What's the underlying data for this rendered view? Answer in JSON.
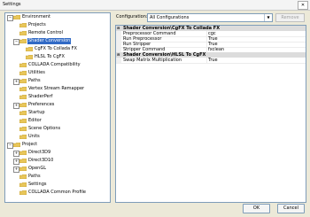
{
  "window": {
    "title": "Settings",
    "close_label": "✕"
  },
  "tree": {
    "items": [
      {
        "label": "Environment",
        "level": 0,
        "expander": "−"
      },
      {
        "label": "Projects",
        "level": 1,
        "expander": ""
      },
      {
        "label": "Remote Control",
        "level": 1,
        "expander": ""
      },
      {
        "label": "Shader Conversion",
        "level": 1,
        "expander": "−",
        "selected": true
      },
      {
        "label": "CgFX To Collada FX",
        "level": 2,
        "expander": ""
      },
      {
        "label": "HLSL To CgFX",
        "level": 2,
        "expander": ""
      },
      {
        "label": "COLLADA Compatibility",
        "level": 1,
        "expander": ""
      },
      {
        "label": "Utilities",
        "level": 1,
        "expander": ""
      },
      {
        "label": "Paths",
        "level": 1,
        "expander": "+"
      },
      {
        "label": "Vertex Stream Remapper",
        "level": 1,
        "expander": ""
      },
      {
        "label": "ShaderPerf",
        "level": 1,
        "expander": ""
      },
      {
        "label": "Preferences",
        "level": 1,
        "expander": "+"
      },
      {
        "label": "Startup",
        "level": 1,
        "expander": ""
      },
      {
        "label": "Editor",
        "level": 1,
        "expander": ""
      },
      {
        "label": "Scene Options",
        "level": 1,
        "expander": ""
      },
      {
        "label": "Units",
        "level": 1,
        "expander": ""
      },
      {
        "label": "Project",
        "level": 0,
        "expander": "−"
      },
      {
        "label": "Direct3D9",
        "level": 1,
        "expander": "+"
      },
      {
        "label": "Direct3D10",
        "level": 1,
        "expander": "+"
      },
      {
        "label": "OpenGL",
        "level": 1,
        "expander": "+"
      },
      {
        "label": "Paths",
        "level": 1,
        "expander": ""
      },
      {
        "label": "Settings",
        "level": 1,
        "expander": ""
      },
      {
        "label": "COLLADA Common Profile",
        "level": 1,
        "expander": ""
      }
    ]
  },
  "config": {
    "label": "Configuration:",
    "selected": "All Configurations",
    "remove_label": "Remove"
  },
  "grid": {
    "sections": [
      {
        "title": "Shader Conversion\\CgFX To Collada FX",
        "rows": [
          {
            "name": "Preprocessor Command",
            "value": "cgc"
          },
          {
            "name": "Run Preprocessor",
            "value": "True"
          },
          {
            "name": "Run Stripper",
            "value": "True"
          },
          {
            "name": "Stripper Command",
            "value": "fxclean"
          }
        ]
      },
      {
        "title": "Shader Conversion\\HLSL To CgFX",
        "rows": [
          {
            "name": "Swap Matrix Multiplication",
            "value": "True"
          }
        ]
      }
    ]
  },
  "buttons": {
    "ok_label": "OK",
    "cancel_label": "Cancel"
  },
  "colors": {
    "selection": "#316ac5",
    "folder": "#e8c65a"
  }
}
